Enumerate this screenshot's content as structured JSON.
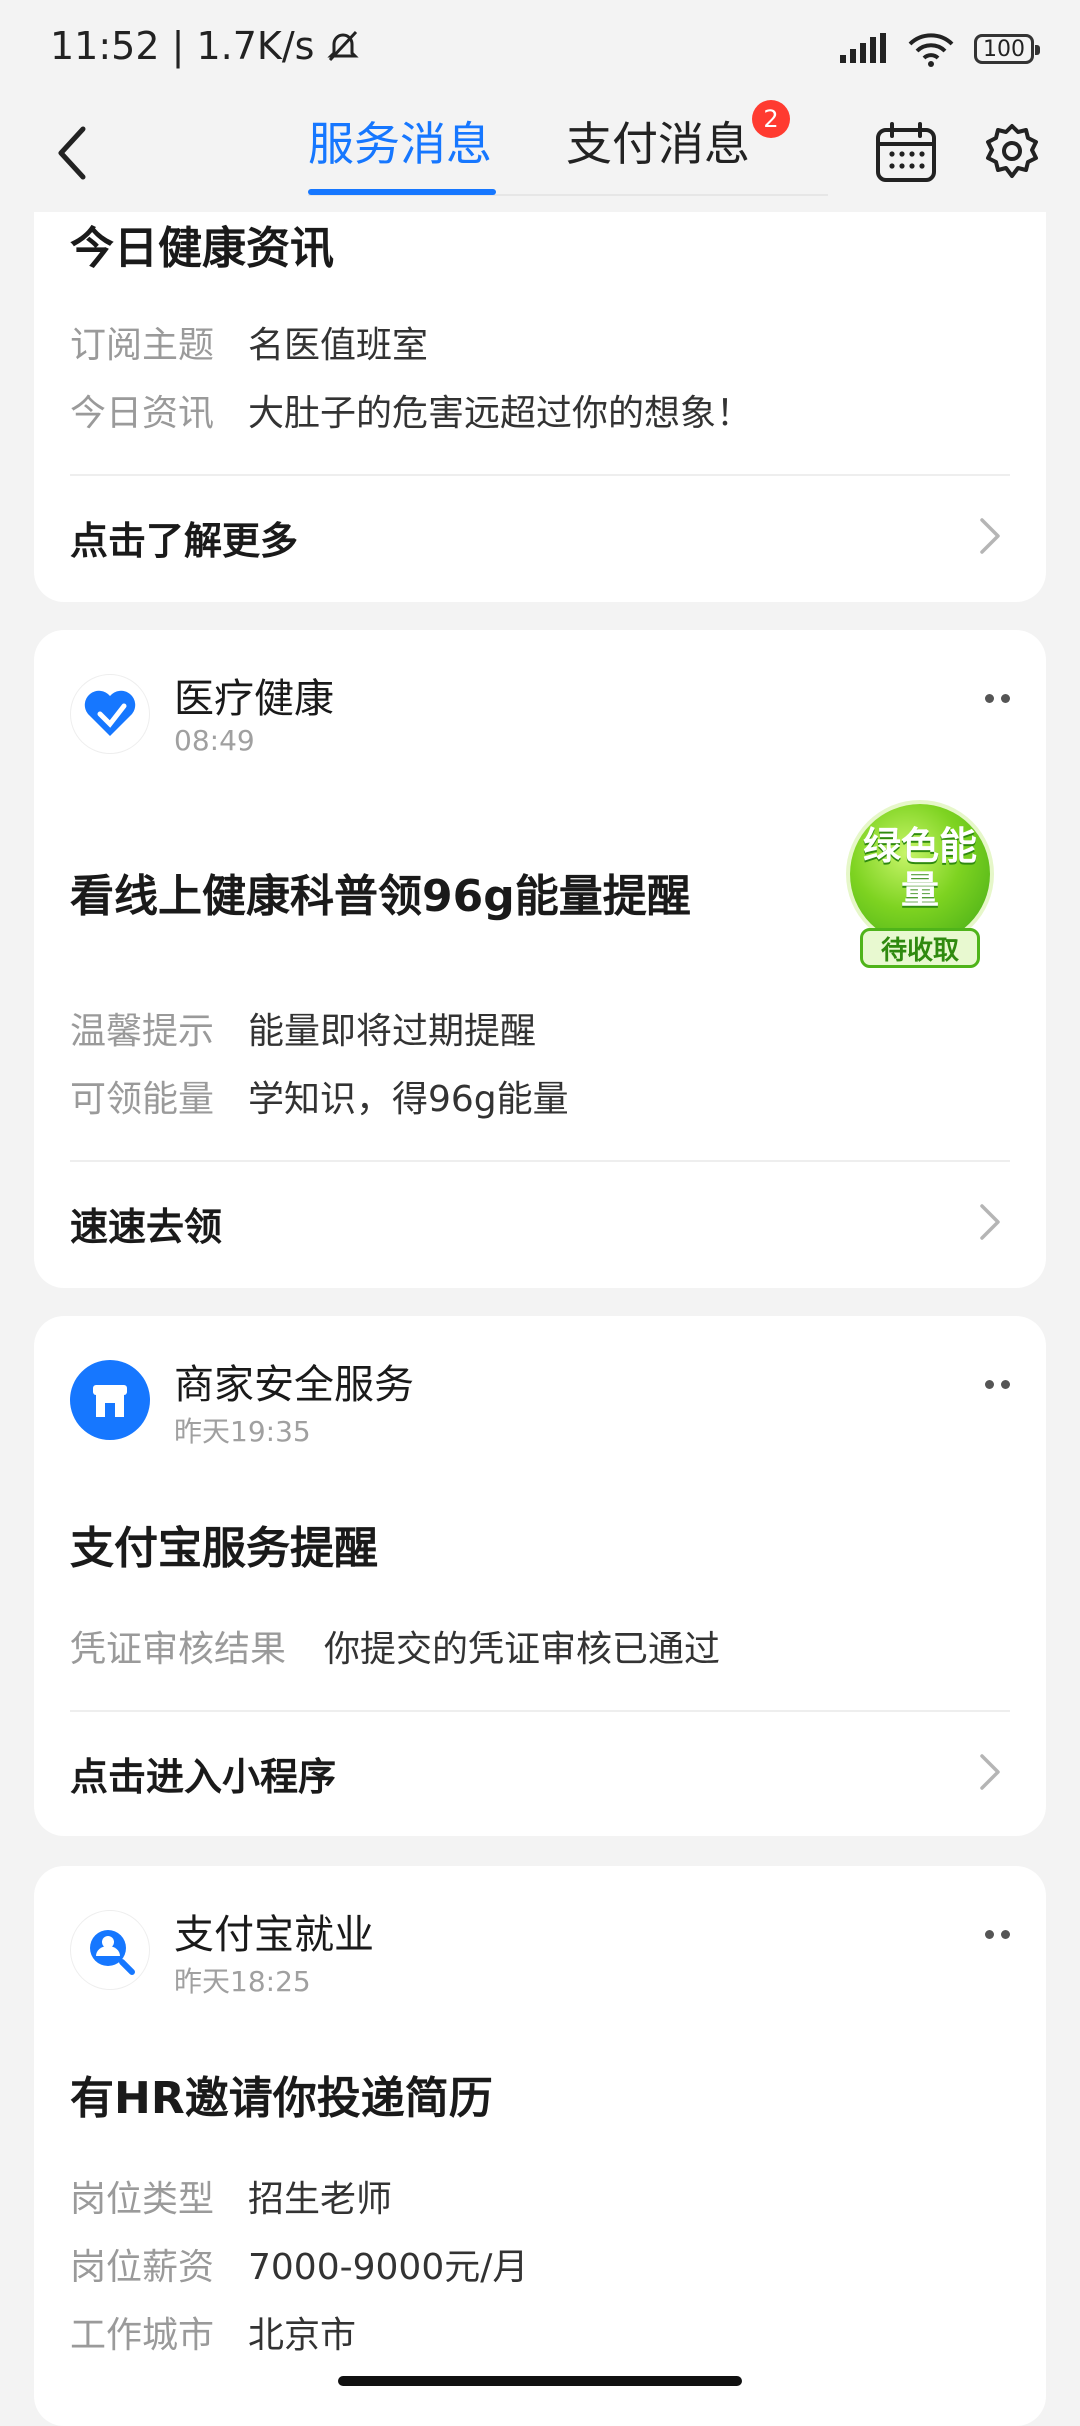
{
  "status_bar": {
    "time_speed": "11:52 | 1.7K/s",
    "battery": "100"
  },
  "nav": {
    "tabs": [
      {
        "label": "服务消息",
        "active": true
      },
      {
        "label": "支付消息",
        "active": false,
        "badge": "2"
      }
    ]
  },
  "cards": [
    {
      "title": "今日健康资讯",
      "rows": [
        {
          "key": "订阅主题",
          "value": "名医值班室"
        },
        {
          "key": "今日资讯",
          "value": "大肚子的危害远超过你的想象！"
        }
      ],
      "action": "点击了解更多"
    },
    {
      "service": "医疗健康",
      "time": "08:49",
      "title": "看线上健康科普领96g能量提醒",
      "energy_badge": {
        "text": "绿色能量",
        "tag": "待收取"
      },
      "rows": [
        {
          "key": "温馨提示",
          "value": "能量即将过期提醒"
        },
        {
          "key": "可领能量",
          "value": "学知识，得96g能量"
        }
      ],
      "action": "速速去领"
    },
    {
      "service": "商家安全服务",
      "time": "昨天19:35",
      "title": "支付宝服务提醒",
      "rows": [
        {
          "key": "凭证审核结果",
          "value": "你提交的凭证审核已通过"
        }
      ],
      "action": "点击进入小程序"
    },
    {
      "service": "支付宝就业",
      "time": "昨天18:25",
      "title": "有HR邀请你投递简历",
      "rows": [
        {
          "key": "岗位类型",
          "value": "招生老师"
        },
        {
          "key": "岗位薪资",
          "value": "7000-9000元/月"
        },
        {
          "key": "工作城市",
          "value": "北京市"
        }
      ]
    }
  ],
  "colors": {
    "accent": "#1677ff",
    "badge": "#ff3b30",
    "energy": "#7ed321"
  },
  "icons": [
    "back-icon",
    "calendar-icon",
    "settings-icon",
    "heart-health-icon",
    "shop-shield-icon",
    "job-search-icon",
    "chevron-right-icon",
    "more-icon",
    "mute-bell-icon",
    "signal-icon",
    "wifi-icon"
  ]
}
